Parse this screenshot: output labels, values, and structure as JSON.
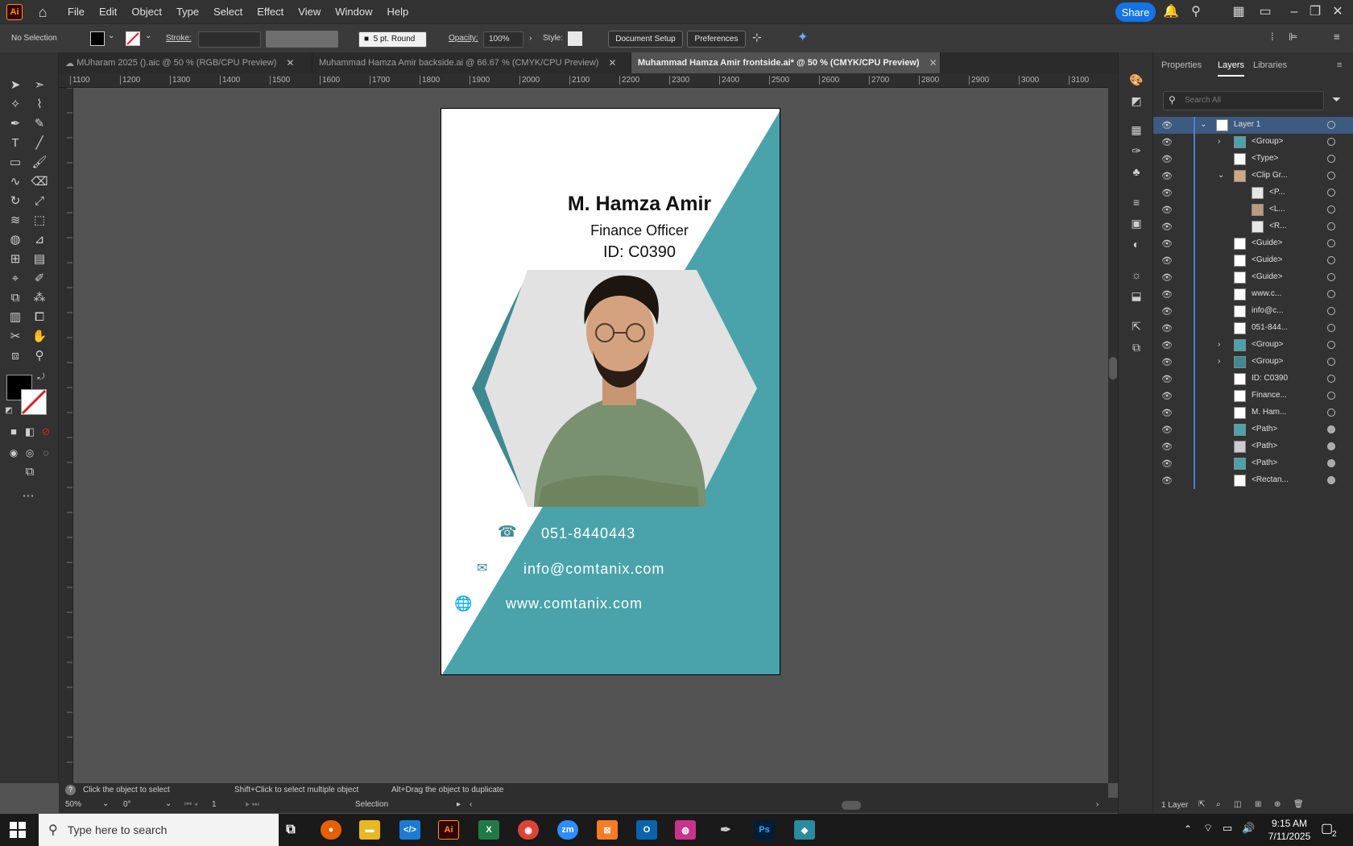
{
  "app": {
    "logo": "Ai"
  },
  "menu": [
    "File",
    "Edit",
    "Object",
    "Type",
    "Select",
    "Effect",
    "View",
    "Window",
    "Help"
  ],
  "topbar": {
    "share_label": "Share"
  },
  "control": {
    "selection": "No Selection",
    "stroke_label": "Stroke:",
    "brush": "5 pt. Round",
    "opacity_label": "Opacity:",
    "opacity_value": "100%",
    "style_label": "Style:",
    "document_setup": "Document Setup",
    "preferences": "Preferences"
  },
  "tabs": [
    {
      "label": "MUharam 2025 ().aic @ 50 % (RGB/CPU Preview)",
      "active": false
    },
    {
      "label": "Muhammad Hamza Amir backside.ai @ 66.67 % (CMYK/CPU Preview)",
      "active": false
    },
    {
      "label": "Muhammad Hamza Amir frontside.ai* @ 50 % (CMYK/CPU Preview)",
      "active": true
    }
  ],
  "ruler_h": [
    "1100",
    "1200",
    "1300",
    "1400",
    "1500",
    "1600",
    "1700",
    "1800",
    "1900",
    "2000",
    "2100",
    "2200",
    "2300",
    "2400",
    "2500",
    "2600",
    "2700",
    "2800",
    "2900",
    "3000",
    "3100"
  ],
  "card": {
    "name": "M. Hamza Amir",
    "title": "Finance Officer",
    "id": "ID: C0390",
    "phone": "051-8440443",
    "email": "info@comtanix.com",
    "web": "www.comtanix.com",
    "teal": "#4aa3ab",
    "dark_teal": "#3e8a92"
  },
  "status": {
    "hint_1": "Click the object to select",
    "hint_2": "Shift+Click to select multiple object",
    "hint_3": "Alt+Drag the object to duplicate",
    "zoom": "50%",
    "rotation": "0°",
    "artboard": "1",
    "tool": "Selection"
  },
  "panel": {
    "tabs": [
      "Properties",
      "Layers",
      "Libraries"
    ],
    "search_placeholder": "Search All",
    "layers": [
      "Layer 1",
      "<Group>",
      "<Type>",
      "<Clip Gr...",
      "<P...",
      "<L...",
      "<R...",
      "<Guide>",
      "<Guide>",
      "<Guide>",
      "www.c...",
      "info@c...",
      "051-844...",
      "<Group>",
      "<Group>",
      "ID: C0390",
      "Finance...",
      "M. Ham...",
      "<Path>",
      "<Path>",
      "<Path>",
      "<Rectan..."
    ],
    "footer": "1 Layer"
  },
  "taskbar": {
    "search_placeholder": "Type here to search",
    "time": "9:15 AM",
    "date": "7/11/2025",
    "notif_count": "2"
  }
}
